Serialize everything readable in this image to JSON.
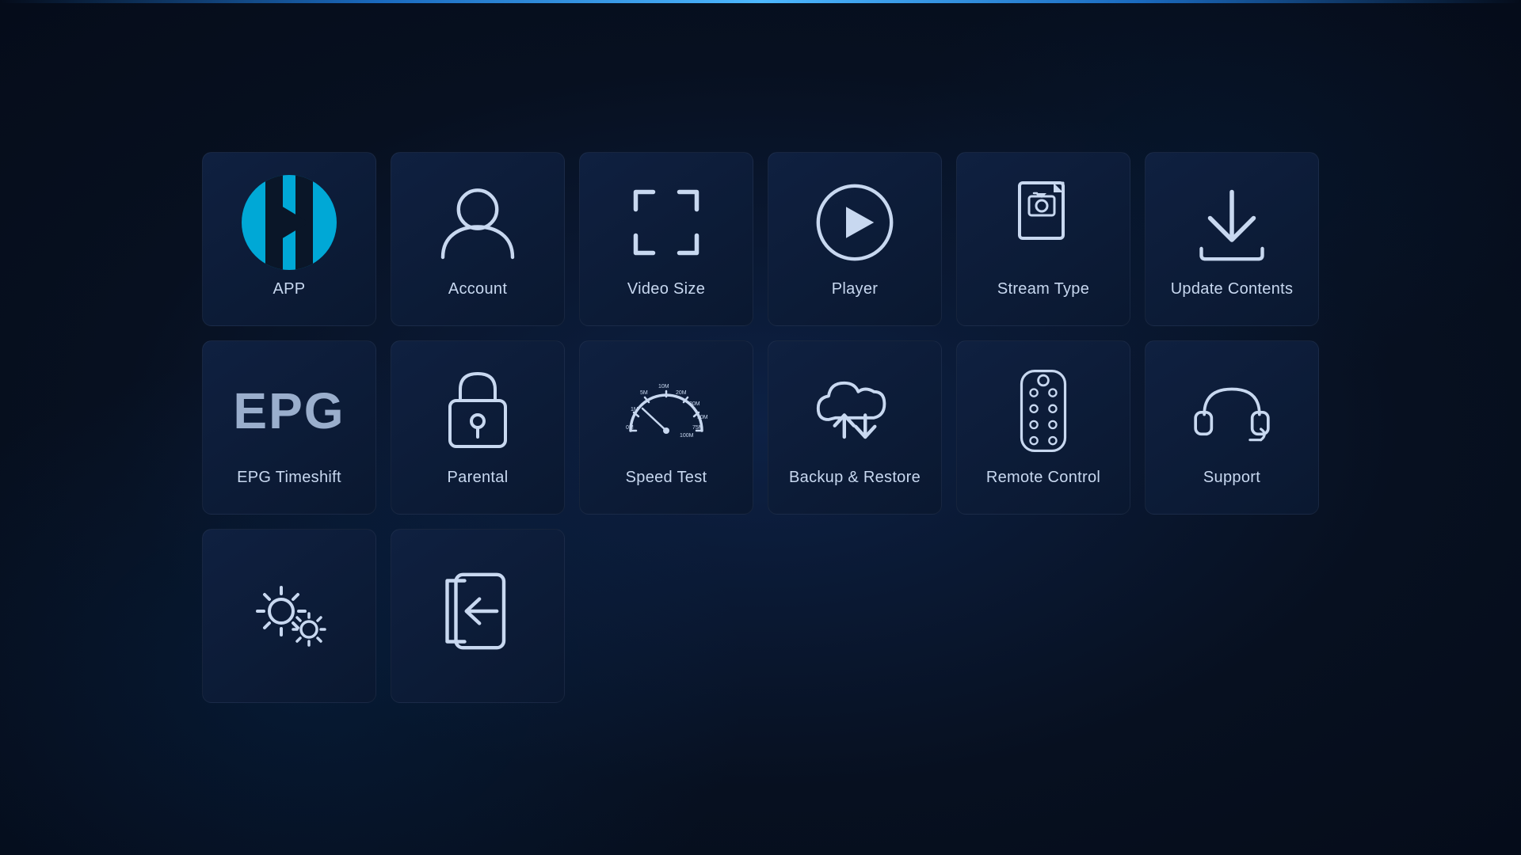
{
  "tiles": [
    {
      "id": "app",
      "label": "APP",
      "icon": "app"
    },
    {
      "id": "account",
      "label": "Account",
      "icon": "account"
    },
    {
      "id": "video-size",
      "label": "Video Size",
      "icon": "video-size"
    },
    {
      "id": "player",
      "label": "Player",
      "icon": "player"
    },
    {
      "id": "stream-type",
      "label": "Stream Type",
      "icon": "stream-type"
    },
    {
      "id": "update-contents",
      "label": "Update Contents",
      "icon": "update-contents"
    },
    {
      "id": "epg-timeshift",
      "label": "EPG Timeshift",
      "icon": "epg"
    },
    {
      "id": "parental",
      "label": "Parental",
      "icon": "parental"
    },
    {
      "id": "speed-test",
      "label": "Speed Test",
      "icon": "speed-test"
    },
    {
      "id": "backup-restore",
      "label": "Backup & Restore",
      "icon": "backup-restore"
    },
    {
      "id": "remote-control",
      "label": "Remote Control",
      "icon": "remote-control"
    },
    {
      "id": "support",
      "label": "Support",
      "icon": "support"
    },
    {
      "id": "settings",
      "label": "",
      "icon": "settings"
    },
    {
      "id": "logout",
      "label": "",
      "icon": "logout"
    }
  ]
}
